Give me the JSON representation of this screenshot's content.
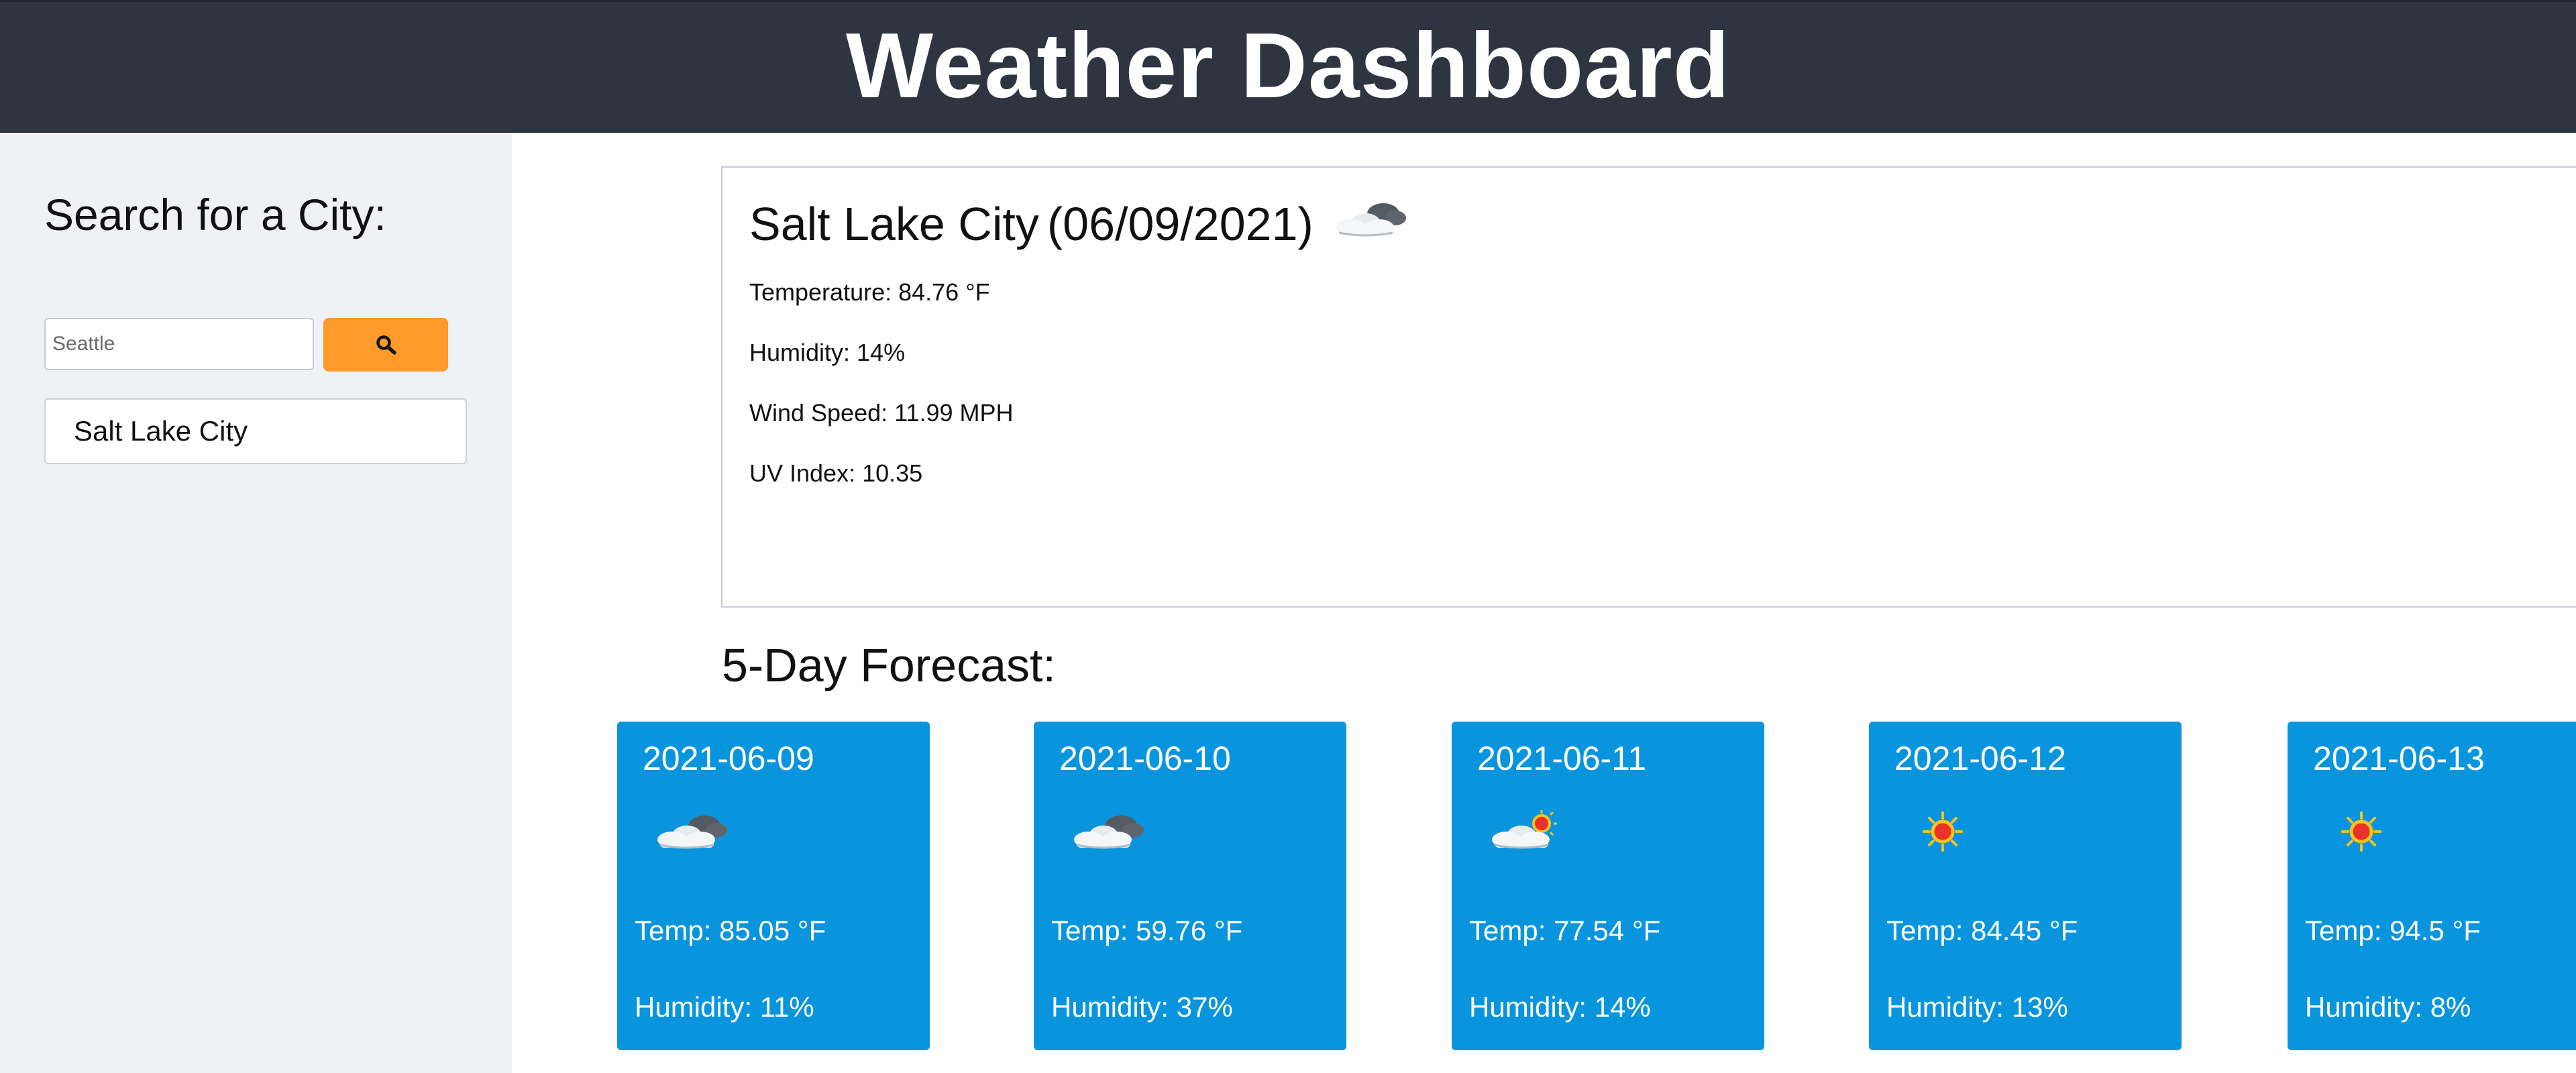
{
  "header": {
    "title": "Weather Dashboard"
  },
  "sidebar": {
    "heading": "Search for a City:",
    "search_placeholder": "Seattle",
    "search_button_icon": "search-icon",
    "history": [
      "Salt Lake City"
    ]
  },
  "current": {
    "city": "Salt Lake City",
    "date": "(06/09/2021)",
    "icon": "partly-cloudy-night-icon",
    "temperature": "Temperature: 84.76 °F",
    "humidity": "Humidity: 14%",
    "wind": "Wind Speed: 11.99 MPH",
    "uv": "UV Index: 10.35"
  },
  "forecast": {
    "heading": "5-Day Forecast:",
    "days": [
      {
        "date": "2021-06-09",
        "icon": "cloudy-night-icon",
        "temp": "Temp: 85.05 °F",
        "humidity": "Humidity: 11%"
      },
      {
        "date": "2021-06-10",
        "icon": "cloudy-night-icon",
        "temp": "Temp: 59.76 °F",
        "humidity": "Humidity: 37%"
      },
      {
        "date": "2021-06-11",
        "icon": "cloud-sun-icon",
        "temp": "Temp: 77.54 °F",
        "humidity": "Humidity: 14%"
      },
      {
        "date": "2021-06-12",
        "icon": "sun-icon",
        "temp": "Temp: 84.45 °F",
        "humidity": "Humidity: 13%"
      },
      {
        "date": "2021-06-13",
        "icon": "sun-icon",
        "temp": "Temp: 94.5 °F",
        "humidity": "Humidity: 8%"
      }
    ]
  },
  "colors": {
    "header_bg": "#2e3440",
    "sidebar_bg": "#f0f1f5",
    "accent_button": "#fd9a2a",
    "forecast_card": "#0995dd"
  }
}
